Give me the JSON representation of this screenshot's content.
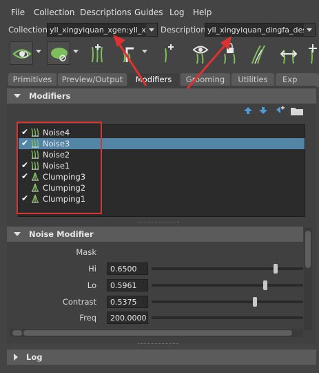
{
  "menu": [
    "File",
    "Collection",
    "Descriptions",
    "Guides",
    "Log",
    "Help"
  ],
  "collection": {
    "label": "Collection",
    "value": "yll_xingyiquan_xgen:yll_xin",
    "description_label": "Description",
    "description_value": "yll_xingyiquan_dingfa_des"
  },
  "toolbar": {
    "icons": [
      "eye-icon",
      "leaf-icon",
      "add-guides-icon",
      "move-guides-icon",
      "add-cv-icon",
      "show-guides-icon",
      "lock-guides-icon",
      "comb-icon",
      "flip-icon",
      "scale-icon"
    ]
  },
  "tabs": [
    "Primitives",
    "Preview/Output",
    "Modifiers",
    "Grooming",
    "Utilities",
    "Exp"
  ],
  "active_tab": "Modifiers",
  "modifiers": {
    "title": "Modifiers",
    "items": [
      {
        "name": "Noise4",
        "checked": true,
        "icon": "noise-icon"
      },
      {
        "name": "Noise3",
        "checked": true,
        "icon": "noise-icon",
        "selected": true
      },
      {
        "name": "Noise2",
        "checked": false,
        "icon": "noise-icon"
      },
      {
        "name": "Noise1",
        "checked": true,
        "icon": "noise-icon"
      },
      {
        "name": "Clumping3",
        "checked": true,
        "icon": "clumping-icon"
      },
      {
        "name": "Clumping2",
        "checked": false,
        "icon": "clumping-icon"
      },
      {
        "name": "Clumping1",
        "checked": true,
        "icon": "clumping-icon"
      }
    ],
    "check_mark": "✔"
  },
  "noise_modifier": {
    "title": "Noise Modifier",
    "mask_label": "Mask",
    "params": [
      {
        "label": "Hi",
        "value": "0.6500",
        "level": 0.82
      },
      {
        "label": "Lo",
        "value": "0.5961",
        "level": 0.75
      },
      {
        "label": "Contrast",
        "value": "0.5375",
        "level": 0.68
      },
      {
        "label": "Freq",
        "value": "200.0000",
        "level": null
      }
    ]
  },
  "log": {
    "title": "Log"
  },
  "colors": {
    "background": "#444444",
    "selection": "#5285a6",
    "annotation_red": "#e03131",
    "icon_green": "#7cbf5a"
  }
}
